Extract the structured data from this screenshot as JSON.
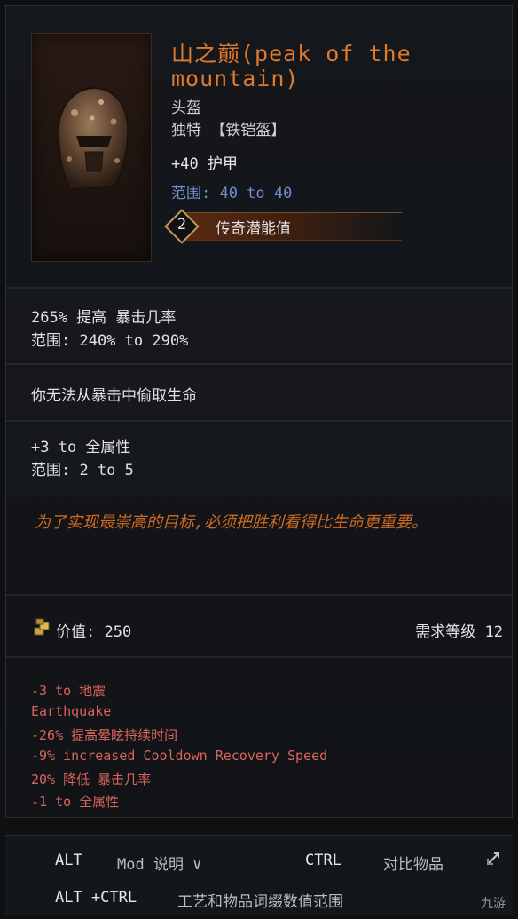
{
  "item": {
    "name": "山之巅(peak of the mountain)",
    "slot": "头盔",
    "rarity_line": "独特  【铁铠盔】",
    "armor_label": "+40 护甲",
    "armor_range": "范围: 40 to 40",
    "legendary_potential": {
      "value": "2",
      "label": "传奇潜能值"
    }
  },
  "affixes": [
    {
      "text": "265% 提高 暴击几率",
      "range": "范围: 240% to 290%"
    },
    {
      "text": "你无法从暴击中偷取生命",
      "range": ""
    },
    {
      "text": "+3 to 全属性",
      "range": "范围: 2 to 5"
    }
  ],
  "lore": "为了实现最崇高的目标,必须把胜利看得比生命更重要。",
  "value": {
    "label": "价值: 250"
  },
  "requirement": {
    "label": "需求等级  12"
  },
  "negative_mods": [
    "-3 to 地震",
    "Earthquake",
    "-26% 提高晕眩持续时间",
    "-9% increased Cooldown Recovery Speed",
    "20% 降低 暴击几率",
    "-1 to 全属性"
  ],
  "footer": {
    "row1": {
      "alt": "ALT",
      "mod": "Mod 说明 ∨",
      "ctrl": "CTRL",
      "compare": "对比物品"
    },
    "row2": {
      "altctrl": "ALT +CTRL",
      "label": "工艺和物品词缀数值范围"
    },
    "watermark": "九游"
  },
  "colors": {
    "title": "#e07a2c",
    "range": "#6f8fcc",
    "lore": "#d06a20",
    "negative": "#d8645c"
  }
}
